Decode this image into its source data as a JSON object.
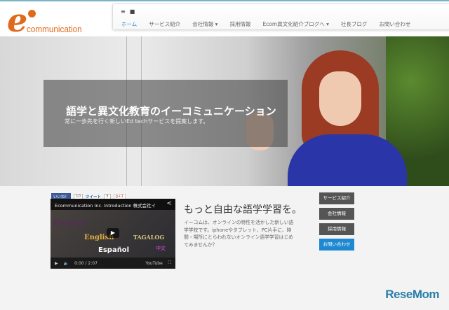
{
  "logo": {
    "mark": "e",
    "text": "communication"
  },
  "nav": {
    "icons": [
      "rss-icon",
      "youtube-icon"
    ],
    "links": [
      {
        "label": "ホーム",
        "active": true
      },
      {
        "label": "サービス紹介"
      },
      {
        "label": "会社情報 ▾"
      },
      {
        "label": "採用情報"
      },
      {
        "label": "Ecom異文化紹介ブログへ ▾"
      },
      {
        "label": "社長ブログ"
      },
      {
        "label": "お問い合わせ"
      }
    ]
  },
  "hero": {
    "title": "語学と異文化教育のイーコミュニケーション",
    "subtitle": "常に一歩先を行く新しいEd techサービスを提案します。"
  },
  "social": {
    "facebook": "いいね！",
    "fb_count": "10",
    "twitter": "ツイート",
    "tw_count": "3",
    "gplus": "g+1"
  },
  "video": {
    "title": "Ecommunication Inc. Introduction 株式会社イ",
    "time": "0:00 / 2:07",
    "youtube": "YouTube",
    "languages": [
      "Deutsch",
      "TAGALOG",
      "English",
      "中文",
      "Español"
    ]
  },
  "main": {
    "headline": "もっと自由な語学学習を。",
    "description": "イーコムは、オンラインの特性を活かした新しい語学学校です。iphoneやタブレット、PC片手に、時間・場所にとらわれないオンライン語学学習はじめてみませんか？"
  },
  "side_buttons": [
    "サービス紹介",
    "会社情報",
    "採用情報",
    "お問い合わせ"
  ],
  "watermark": "ReseMom"
}
